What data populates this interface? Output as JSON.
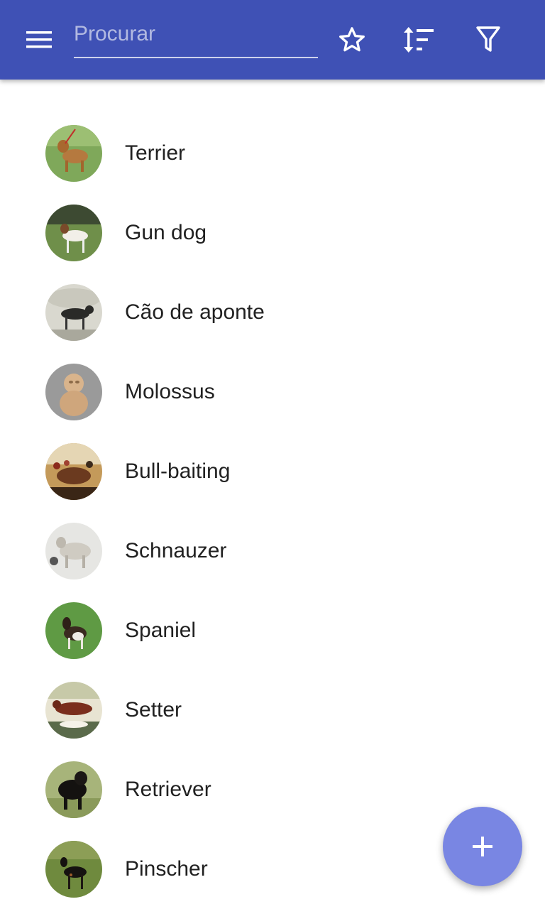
{
  "colors": {
    "primary": "#3f51b5",
    "accent": "#7986e3",
    "text": "#212121"
  },
  "toolbar": {
    "menu_icon": "menu-icon",
    "search": {
      "placeholder": "Procurar",
      "value": ""
    },
    "actions": [
      {
        "name": "favorites",
        "icon": "star-outline-icon"
      },
      {
        "name": "sort",
        "icon": "sort-icon"
      },
      {
        "name": "filter",
        "icon": "filter-icon"
      }
    ]
  },
  "list": {
    "items": [
      {
        "label": "Terrier",
        "thumb": "terrier-photo"
      },
      {
        "label": "Gun dog",
        "thumb": "gun-dog-photo"
      },
      {
        "label": "Cão de aponte",
        "thumb": "pointer-dog-photo"
      },
      {
        "label": "Molossus",
        "thumb": "molossus-photo"
      },
      {
        "label": "Bull-baiting",
        "thumb": "bull-baiting-photo"
      },
      {
        "label": "Schnauzer",
        "thumb": "schnauzer-photo"
      },
      {
        "label": "Spaniel",
        "thumb": "spaniel-photo"
      },
      {
        "label": "Setter",
        "thumb": "setter-photo"
      },
      {
        "label": "Retriever",
        "thumb": "retriever-photo"
      },
      {
        "label": "Pinscher",
        "thumb": "pinscher-photo"
      }
    ]
  },
  "fab": {
    "icon": "plus-icon"
  }
}
